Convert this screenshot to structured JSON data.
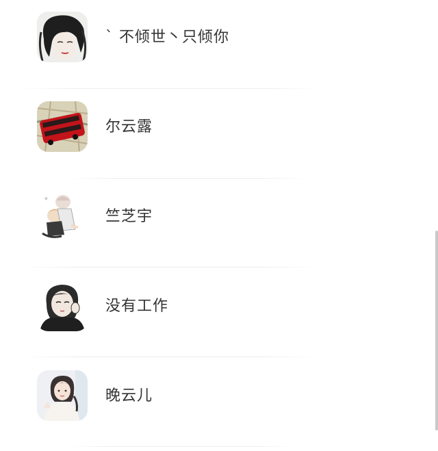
{
  "contacts": [
    {
      "name": "ˋ 不倾世丶只倾你",
      "avatar": "ink-sketch-man-avatar"
    },
    {
      "name": "尔云露",
      "avatar": "red-double-decker-bus-avatar"
    },
    {
      "name": "竺芝宇",
      "avatar": "anime-couple-avatar"
    },
    {
      "name": "没有工作",
      "avatar": "cartoon-girl-avatar"
    },
    {
      "name": "晚云儿",
      "avatar": "girl-photo-avatar"
    }
  ],
  "colors": {
    "background": "#ffffff",
    "text": "#333333",
    "divider": "#ececec",
    "scrollbar": "#c9c9c9"
  }
}
